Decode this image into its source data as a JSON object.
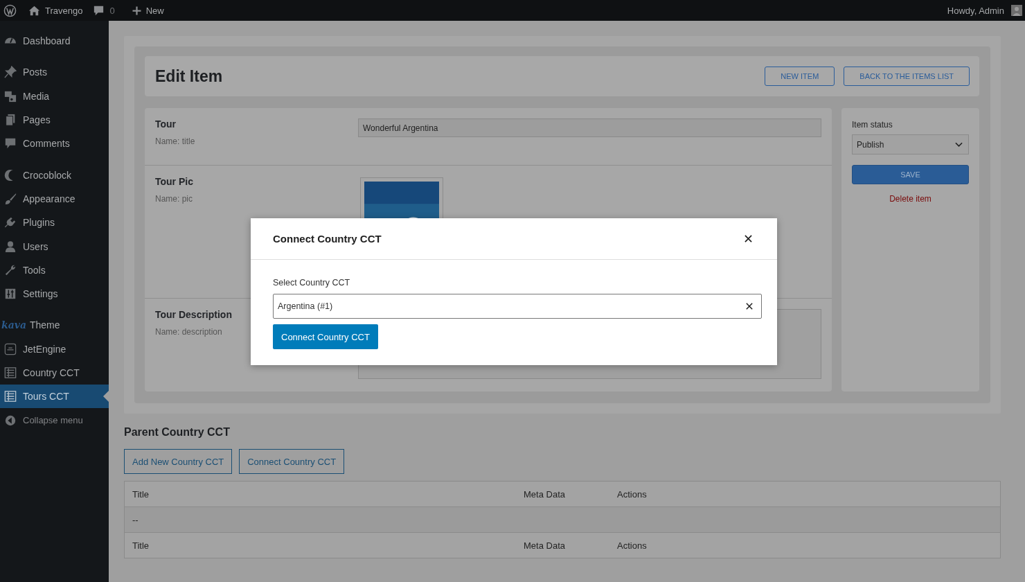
{
  "admin_bar": {
    "site": "Travengo",
    "comments": "0",
    "new": "New",
    "greeting": "Howdy, Admin"
  },
  "sidebar": {
    "items": [
      {
        "label": "Dashboard",
        "selected": false
      },
      {
        "label": "Posts",
        "selected": false
      },
      {
        "label": "Media",
        "selected": false
      },
      {
        "label": "Pages",
        "selected": false
      },
      {
        "label": "Comments",
        "selected": false
      },
      {
        "label": "Crocoblock",
        "selected": false
      },
      {
        "label": "Appearance",
        "selected": false
      },
      {
        "label": "Plugins",
        "selected": false
      },
      {
        "label": "Users",
        "selected": false
      },
      {
        "label": "Tools",
        "selected": false
      },
      {
        "label": "Settings",
        "selected": false
      },
      {
        "label": "Theme",
        "logo": "kava",
        "selected": false
      },
      {
        "label": "JetEngine",
        "selected": false
      },
      {
        "label": "Country CCT",
        "selected": false
      },
      {
        "label": "Tours CCT",
        "selected": true
      },
      {
        "label": "Collapse menu",
        "selected": false
      }
    ]
  },
  "editor": {
    "title": "Edit Item",
    "header_buttons": [
      "NEW ITEM",
      "BACK TO THE ITEMS LIST"
    ],
    "fields": [
      {
        "kind": "text",
        "label": "Tour",
        "name": "Name: title",
        "value": "Wonderful Argentina"
      },
      {
        "label": "Tour Pic",
        "name": "Name: pic"
      },
      {
        "kind": "textarea",
        "label": "Tour Description",
        "name": "Name: description"
      }
    ],
    "status_panel": {
      "label": "Item status",
      "value": "Publish",
      "save": "SAVE",
      "delete": "Delete item"
    }
  },
  "related": {
    "title": "Parent Country CCT",
    "buttons": [
      "Add New Country CCT",
      "Connect Country CCT"
    ],
    "table": {
      "columns": [
        "Title",
        "Meta Data",
        "Actions"
      ],
      "rows": [
        [
          "--"
        ]
      ],
      "footer": [
        "Title",
        "Meta Data",
        "Actions"
      ]
    }
  },
  "modal": {
    "title": "Connect Country CCT",
    "field_label": "Select Country CCT",
    "value": "Argentina (#1)",
    "submit": "Connect Country CCT"
  }
}
